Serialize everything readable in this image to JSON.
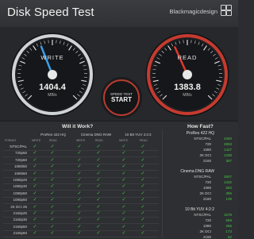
{
  "app": {
    "title": "Disk Speed Test",
    "brand": "Blackmagicdesign"
  },
  "write": {
    "label": "WRITE",
    "value": "1404.4",
    "unit": "MB/s",
    "fraction": 0.42
  },
  "read": {
    "label": "READ",
    "value": "1383.8",
    "unit": "MB/s",
    "fraction": 0.41
  },
  "start": {
    "line1": "SPEED TEST",
    "line2": "START"
  },
  "will": {
    "title": "Will it Work?",
    "format_label": "FORMAT",
    "columns": [
      "ProRes 422 HQ",
      "Cinema DNG RAW",
      "10 Bit YUV 4:2:2"
    ],
    "sub": [
      "WRITE",
      "READ",
      "WRITE",
      "READ",
      "WRITE",
      "READ"
    ],
    "rows": [
      "NTSC/PAL",
      "720p50",
      "720p60",
      "1080i50",
      "1080i60",
      "1080p25",
      "1080p30",
      "1080p50",
      "1080p60",
      "2K DCI 25",
      "2160p25",
      "2160p30",
      "2160p50",
      "2160p60"
    ],
    "check": "✓"
  },
  "fast": {
    "title": "How Fast?",
    "groups": [
      {
        "name": "ProRes 422 HQ",
        "rows": [
          [
            "NTSC/PAL",
            "4260"
          ],
          [
            "720",
            "2853"
          ],
          [
            "1080",
            "1427"
          ],
          [
            "2K DCI",
            "1338"
          ],
          [
            "2160",
            "357"
          ]
        ]
      },
      {
        "name": "Cinema DNG RAW",
        "rows": [
          [
            "NTSC/PAL",
            "3507"
          ],
          [
            "720",
            "1332"
          ],
          [
            "1080",
            "592"
          ],
          [
            "2K DCI",
            "385"
          ],
          [
            "2160",
            "139"
          ]
        ]
      },
      {
        "name": "10 Bit YUV 4:2:2",
        "rows": [
          [
            "NTSC/PAL",
            "1578"
          ],
          [
            "720",
            "589"
          ],
          [
            "1080",
            "266"
          ],
          [
            "2K DCI",
            "173"
          ],
          [
            "2160",
            "62"
          ]
        ]
      }
    ]
  }
}
